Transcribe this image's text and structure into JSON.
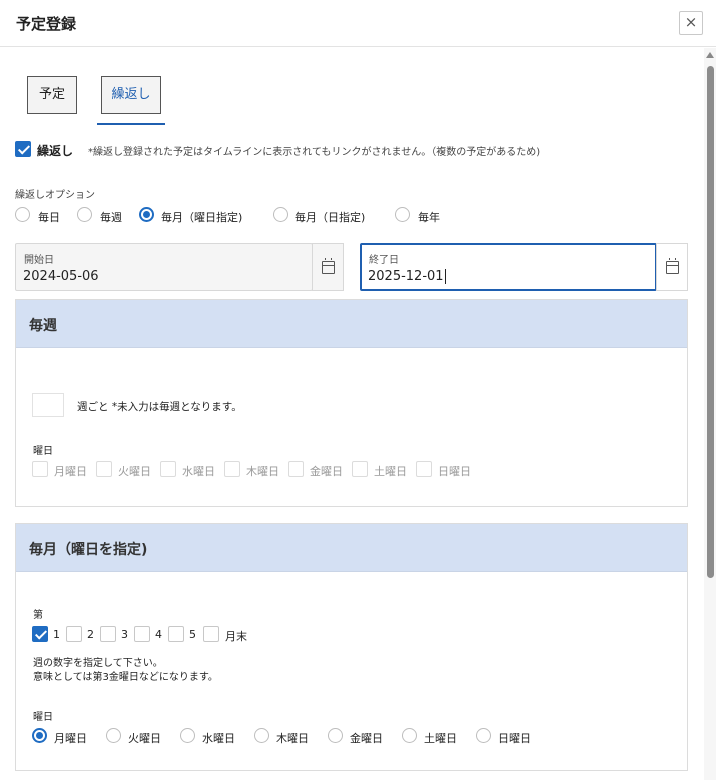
{
  "dialog": {
    "title": "予定登録",
    "close_icon": "×"
  },
  "tabs": [
    {
      "label": "予定"
    },
    {
      "label": "繰返し"
    }
  ],
  "repeat": {
    "checkbox_label": "繰返し",
    "checked": true,
    "note": "*繰返し登録された予定はタイムラインに表示されてもリンクがされません。（複数の予定があるため)"
  },
  "options": {
    "label": "繰返しオプション",
    "items": [
      "毎日",
      "毎週",
      "毎月（曜日指定)",
      "毎月（日指定)",
      "毎年"
    ],
    "selected_index": 2
  },
  "dates": {
    "start_label": "開始日",
    "start_value": "2024-05-06",
    "end_label": "終了日",
    "end_value": "2025-12-01"
  },
  "weekly": {
    "title": "毎週",
    "interval_value": "",
    "interval_text": "週ごと *未入力は毎週となります。",
    "weekday_label": "曜日",
    "weekdays": [
      "月曜日",
      "火曜日",
      "水曜日",
      "木曜日",
      "金曜日",
      "土曜日",
      "日曜日"
    ]
  },
  "monthly": {
    "title": "毎月（曜日を指定)",
    "nth_label": "第",
    "nth_items": [
      "1",
      "2",
      "3",
      "4",
      "5"
    ],
    "nth_checked": [
      true,
      false,
      false,
      false,
      false
    ],
    "nth_suffix": "月末",
    "help_line1": "週の数字を指定して下さい。",
    "help_line2": "意味としては第3金曜日などになります。",
    "weekday_label": "曜日",
    "weekdays": [
      "月曜日",
      "火曜日",
      "水曜日",
      "木曜日",
      "金曜日",
      "土曜日",
      "日曜日"
    ],
    "weekday_selected_index": 0
  },
  "colors": {
    "accent": "#1f6cc2",
    "panel_header": "#d4e0f3"
  }
}
